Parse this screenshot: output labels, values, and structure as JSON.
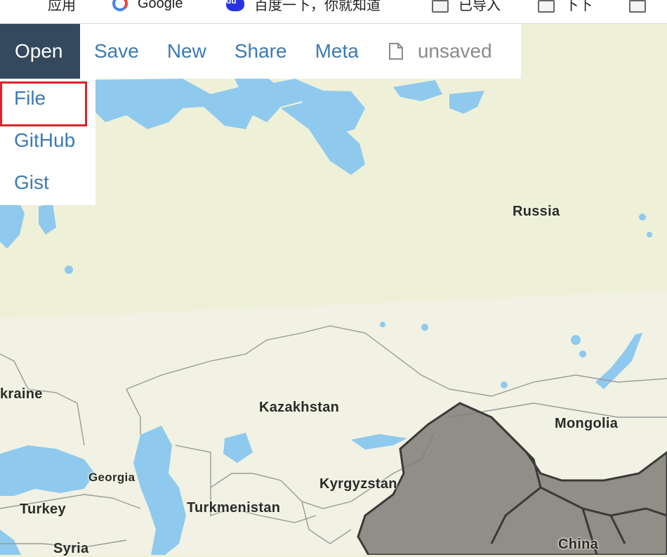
{
  "bookmarks": [
    {
      "label": "应用",
      "icon": "apps-grid-icon"
    },
    {
      "label": "Google",
      "icon": "google-icon"
    },
    {
      "label": "百度一下，你就知道",
      "icon": "baidu-icon"
    },
    {
      "label": "已导入",
      "icon": "folder-icon"
    },
    {
      "label": "下下",
      "icon": "folder-icon"
    },
    {
      "label": "",
      "icon": "folder-icon"
    }
  ],
  "menu": {
    "open": "Open",
    "save": "Save",
    "new": "New",
    "share": "Share",
    "meta": "Meta",
    "status": "unsaved",
    "status_icon": "file-icon"
  },
  "dropdown": {
    "items": [
      "File",
      "GitHub",
      "Gist"
    ],
    "highlighted": "File",
    "highlight_color": "#e0212a"
  },
  "map": {
    "labels": {
      "russia": "Russia",
      "kazakhstan": "Kazakhstan",
      "mongolia": "Mongolia",
      "ukraine": "kraine",
      "georgia": "Georgia",
      "kyrgyzstan": "Kyrgyzstan",
      "turkey": "Turkey",
      "turkmenistan": "Turkmenistan",
      "syria": "Syria",
      "china": "China"
    },
    "colors": {
      "land": "#eef1d8",
      "water": "#8fc9ee",
      "highlight_region": "#7f7d75",
      "accent": "#3c7ab5",
      "active_menu": "#34495e"
    }
  }
}
